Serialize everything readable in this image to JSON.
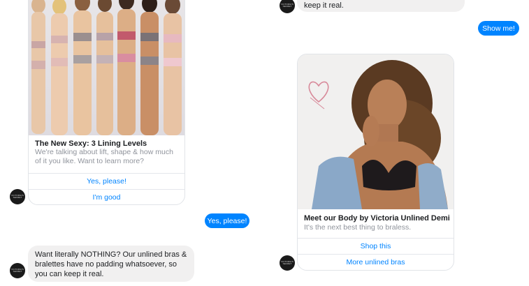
{
  "conversation": {
    "left_column": {
      "card": {
        "title": "The New Sexy: 3 Lining Levels",
        "subtitle": "We're talking about lift, shape & how much of it you like. Want to learn more?",
        "buttons": [
          "Yes, please!",
          "I'm good"
        ]
      },
      "user_reply": "Yes, please!",
      "bot_message": "Want literally NOTHING? Our unlined bras & bralettes have no padding whatsoever, so you can keep it real."
    },
    "right_column": {
      "bot_message_tail": "keep it real.",
      "user_reply": "Show me!",
      "card": {
        "title": "Meet our Body by Victoria Unlined Demi",
        "subtitle": "It's the next best thing to braless.",
        "buttons": [
          "Shop this",
          "More unlined bras"
        ]
      }
    },
    "avatar_icon": "brand-avatar-icon"
  },
  "colors": {
    "accent_blue": "#0084ff",
    "bubble_gray": "#f1f0f0",
    "text_secondary": "#90949c",
    "avatar": "#1a1a1a"
  }
}
